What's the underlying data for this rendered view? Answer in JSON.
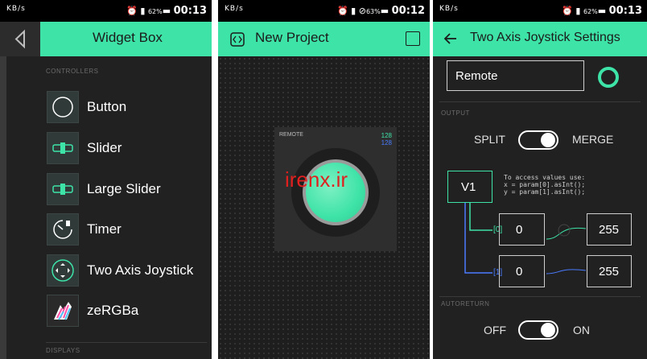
{
  "statusbar": {
    "left_label": "KB/s",
    "battery_a": "62%",
    "battery_b": "63%",
    "time_a": "00:13",
    "time_b": "00:12",
    "time_c": "00:13"
  },
  "panel1": {
    "title": "Widget Box",
    "section_controllers": "CONTROLLERS",
    "section_displays": "DISPLAYS",
    "items": [
      {
        "label": "Button",
        "icon": "button-icon"
      },
      {
        "label": "Slider",
        "icon": "slider-icon"
      },
      {
        "label": "Large Slider",
        "icon": "large-slider-icon"
      },
      {
        "label": "Timer",
        "icon": "timer-icon"
      },
      {
        "label": "Two Axis Joystick",
        "icon": "joystick-icon"
      },
      {
        "label": "zeRGBa",
        "icon": "zergba-icon"
      }
    ]
  },
  "panel2": {
    "title": "New Project",
    "widget_label": "REMOTE",
    "value_x": "128",
    "value_y": "128",
    "watermark": "irenx.ir"
  },
  "panel3": {
    "title": "Two Axis Joystick Settings",
    "name_value": "Remote",
    "section_output": "OUTPUT",
    "split_label": "SPLIT",
    "merge_label": "MERGE",
    "pin": "V1",
    "code_lines": [
      "To access values use:",
      "x = param[0].asInt();",
      "y = param[1].asInt();"
    ],
    "idx0": "[0]",
    "idx1": "[1]",
    "min0": "0",
    "max0": "255",
    "min1": "0",
    "max1": "255",
    "section_autoreturn": "AUTORETURN",
    "off_label": "OFF",
    "on_label": "ON"
  },
  "colors": {
    "accent": "#3ee3a8",
    "dark_bg": "#212121",
    "wire_green": "#3ee3a8",
    "wire_blue": "#4a7bff"
  }
}
